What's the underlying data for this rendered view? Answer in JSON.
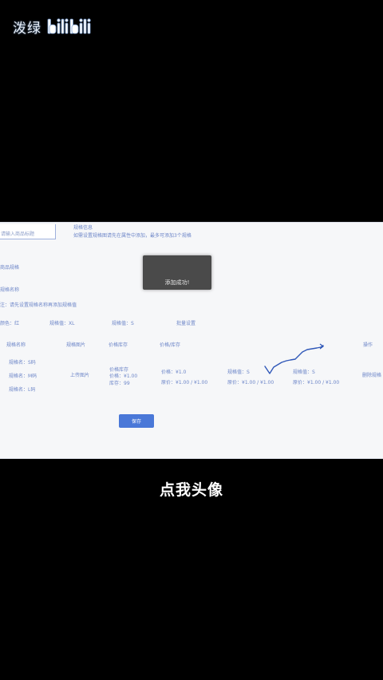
{
  "watermark": {
    "text": "泼绿",
    "logo_text": "bilibili"
  },
  "screen": {
    "top_input_placeholder": "请输入商品标题",
    "section_title": "规格信息",
    "section_desc": "如需设置规格图请先在属性中添加，最多可添加3个规格",
    "label_a": "商品规格",
    "label_b": "规格名称",
    "hint": "注：请先设置规格名称再添加规格值",
    "spec_row": [
      "颜色：红",
      "规格值：XL",
      "规格值：S",
      "批量设置"
    ],
    "toast_text": "添加成功!",
    "table_headers": [
      "规格名称",
      "规格图片",
      "价格库存",
      "价格/库存",
      "操作"
    ],
    "rows": {
      "col1": [
        "规格名：S码",
        "规格名：M码",
        "规格名：L码"
      ],
      "col2": "上传图片",
      "col3": [
        "价格库存",
        "价格：¥1.00",
        "库存：99"
      ],
      "col4": [
        "价格：¥1.0",
        "原价：¥1.00 / ¥1.00"
      ],
      "col5": [
        "规格值：S",
        "原价：¥1.00 / ¥1.00"
      ],
      "col6": [
        "规格值：S",
        "原价：¥1.00 / ¥1.00"
      ],
      "col7": "删除规格"
    },
    "save_button": "保存"
  },
  "caption": "点我头像"
}
